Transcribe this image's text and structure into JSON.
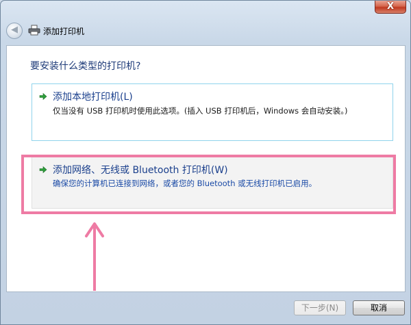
{
  "window": {
    "title": "添加打印机",
    "close_glyph": "X",
    "back_glyph": "◀"
  },
  "main": {
    "heading": "要安装什么类型的打印机?",
    "options": [
      {
        "title": "添加本地打印机(L)",
        "description": "仅当没有 USB 打印机时使用此选项。(插入 USB 打印机后，Windows 会自动安装。)",
        "icon": "green-arrow-icon"
      },
      {
        "title": "添加网络、无线或 Bluetooth 打印机(W)",
        "description": "确保您的计算机已连接到网络，或者您的 Bluetooth 或无线打印机已启用。",
        "icon": "green-arrow-icon"
      }
    ]
  },
  "buttons": {
    "next_label": "下一步(N)",
    "cancel_label": "取消"
  },
  "colors": {
    "highlight": "#ee7ba4",
    "link_blue": "#1a3f8c",
    "heading_blue": "#1d3a78"
  }
}
